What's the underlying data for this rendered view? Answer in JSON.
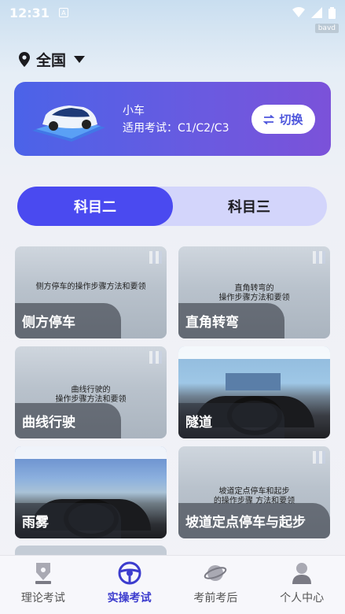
{
  "status_bar": {
    "time": "12:31",
    "a_badge": "A",
    "corner_tag": "bavd"
  },
  "location": {
    "label": "全国"
  },
  "vehicle": {
    "name": "小车",
    "exam_text": "适用考试：C1/C2/C3",
    "switch_label": "切换",
    "accent": "#4b63e8"
  },
  "tabs": [
    {
      "label": "科目二",
      "active": true
    },
    {
      "label": "科目三",
      "active": false
    }
  ],
  "cards": [
    {
      "title": "侧方停车",
      "caption_line1": "侧方停车的操作步骤方法和要领",
      "caption_line2": ""
    },
    {
      "title": "直角转弯",
      "caption_line1": "直角转弯的",
      "caption_line2": "操作步骤方法和要领"
    },
    {
      "title": "曲线行驶",
      "caption_line1": "曲线行驶的",
      "caption_line2": "操作步骤方法和要领"
    },
    {
      "title": "隧道",
      "caption_line1": "",
      "caption_line2": ""
    },
    {
      "title": "雨雾",
      "caption_line1": "",
      "caption_line2": ""
    },
    {
      "title": "坡道定点停车与起步",
      "caption_line1": "坡道定点停车和起步",
      "caption_line2": "的操作步骤 方法和要领"
    }
  ],
  "bottom_nav": [
    {
      "label": "理论考试",
      "icon": "pen-nib-icon",
      "active": false
    },
    {
      "label": "实操考试",
      "icon": "steering-wheel-icon",
      "active": true
    },
    {
      "label": "考前考后",
      "icon": "planet-icon",
      "active": false
    },
    {
      "label": "个人中心",
      "icon": "user-icon",
      "active": false
    }
  ],
  "colors": {
    "active": "#3c3cce",
    "tab_active_bg": "#4a4af0",
    "tab_bg": "#d3d5fb"
  }
}
